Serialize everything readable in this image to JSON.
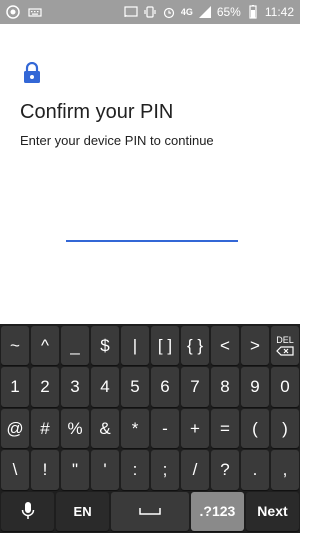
{
  "status_bar": {
    "battery_percent": "65%",
    "time": "11:42",
    "network": "4G",
    "icons": [
      "aperture-icon",
      "keyboard-icon",
      "cast-icon",
      "vibrate-icon",
      "alarm-icon",
      "signal-icon",
      "battery-icon"
    ]
  },
  "screen": {
    "title": "Confirm your PIN",
    "subtitle": "Enter your device PIN to continue",
    "pin_value": "",
    "accent_color": "#3367d6"
  },
  "keyboard": {
    "row1": [
      "~",
      "^",
      "_",
      "$",
      "|",
      "[ ]",
      "{ }",
      "<",
      ">"
    ],
    "delete_label": "DEL",
    "row2": [
      "1",
      "2",
      "3",
      "4",
      "5",
      "6",
      "7",
      "8",
      "9",
      "0"
    ],
    "row3": [
      "@",
      "#",
      "%",
      "&",
      "*",
      "-",
      "+",
      "=",
      "(",
      ")"
    ],
    "row4": [
      "\\",
      "!",
      "\"",
      "'",
      ":",
      ";",
      "/",
      "?",
      ".",
      ","
    ],
    "language_label": "EN",
    "symbols_label": ".?123",
    "next_label": "Next"
  }
}
